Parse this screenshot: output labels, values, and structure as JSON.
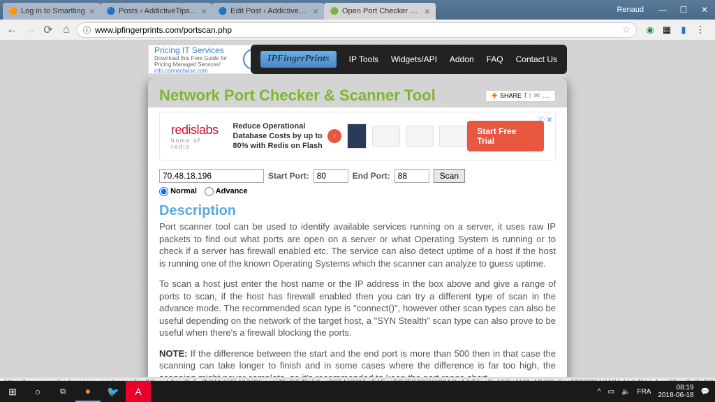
{
  "titlebar": {
    "user": "Renaud",
    "tabs": [
      {
        "title": "Log in to Smartling",
        "favicon": "🟠"
      },
      {
        "title": "Posts ‹ AddictiveTips — ...",
        "favicon": "🔵"
      },
      {
        "title": "Edit Post ‹ AddictiveTips",
        "favicon": "🔵"
      },
      {
        "title": "Open Port Checker & Sc...",
        "favicon": "🟢"
      }
    ]
  },
  "toolbar": {
    "url": "www.ipfingerprints.com/portscan.php"
  },
  "left_ad": {
    "headline": "Pricing IT Services",
    "sub": "Download this Free Guide for Pricing Managed Services!",
    "domain": "info.connectwise.com"
  },
  "nav": {
    "logo": "IPFingerPrints",
    "links": [
      "IP Tools",
      "Widgets/API",
      "Addon",
      "FAQ",
      "Contact Us"
    ]
  },
  "page_title": "Network Port Checker & Scanner Tool",
  "share_label": "SHARE",
  "banner": {
    "brand": "redislabs",
    "sub": "home of redis",
    "text": "Reduce Operational Database Costs by up to 80% with Redis on Flash",
    "cta": "Start Free Trial"
  },
  "form": {
    "ip": "70.48.18.196",
    "start_label": "Start Port:",
    "start_port": "80",
    "end_label": "End Port:",
    "end_port": "88",
    "scan_label": "Scan",
    "modes": {
      "normal": "Normal",
      "advance": "Advance"
    }
  },
  "desc": {
    "heading": "Description",
    "p1": "Port scanner tool can be used to identify available services running on a server, it uses raw IP packets to find out what ports are open on a server or what Operating System is running or to check if a server has firewall enabled etc. The service can also detect uptime of a host if the host is running one of the known Operating Systems which the scanner can analyze to guess uptime.",
    "p2": "To scan a host just enter the host name or the IP address in the box above and give a range of ports to scan, if the host has firewall enabled then you can try a different type of scan in the advance mode. The recommended scan type is \"connect()\", however other scan types can also be useful depending on the network of the target host, a \"SYN Stealth\" scan type can also prove to be useful when there's a firewall blocking the ports.",
    "note_label": "NOTE:",
    "note": "If the difference between the start and the end port is more than 500 then in that case the scanning can take longer to finish and in some cases where the difference is far too high, the scanning might never complete, so it's recommended to keep the port range short."
  },
  "status_url": "https://www.googleadservices.com/pagead/aclk?sa=L&ai=C_5_dNKMnW5LNHYOtogazj7TgDZvf6phSuoO80-MG3NkeEAEgnPOdFGD96KK88AOgAZrT6ooDyAECqAMByAPJ8KoEqgFP0DP0i1XAIMuHubZNHyAvrcSPgeQqCoRGJPm1ecK0rvWc4n377TRbzRq...",
  "taskbar": {
    "lang": "FRA",
    "time": "08:19",
    "date": "2018-06-18"
  }
}
